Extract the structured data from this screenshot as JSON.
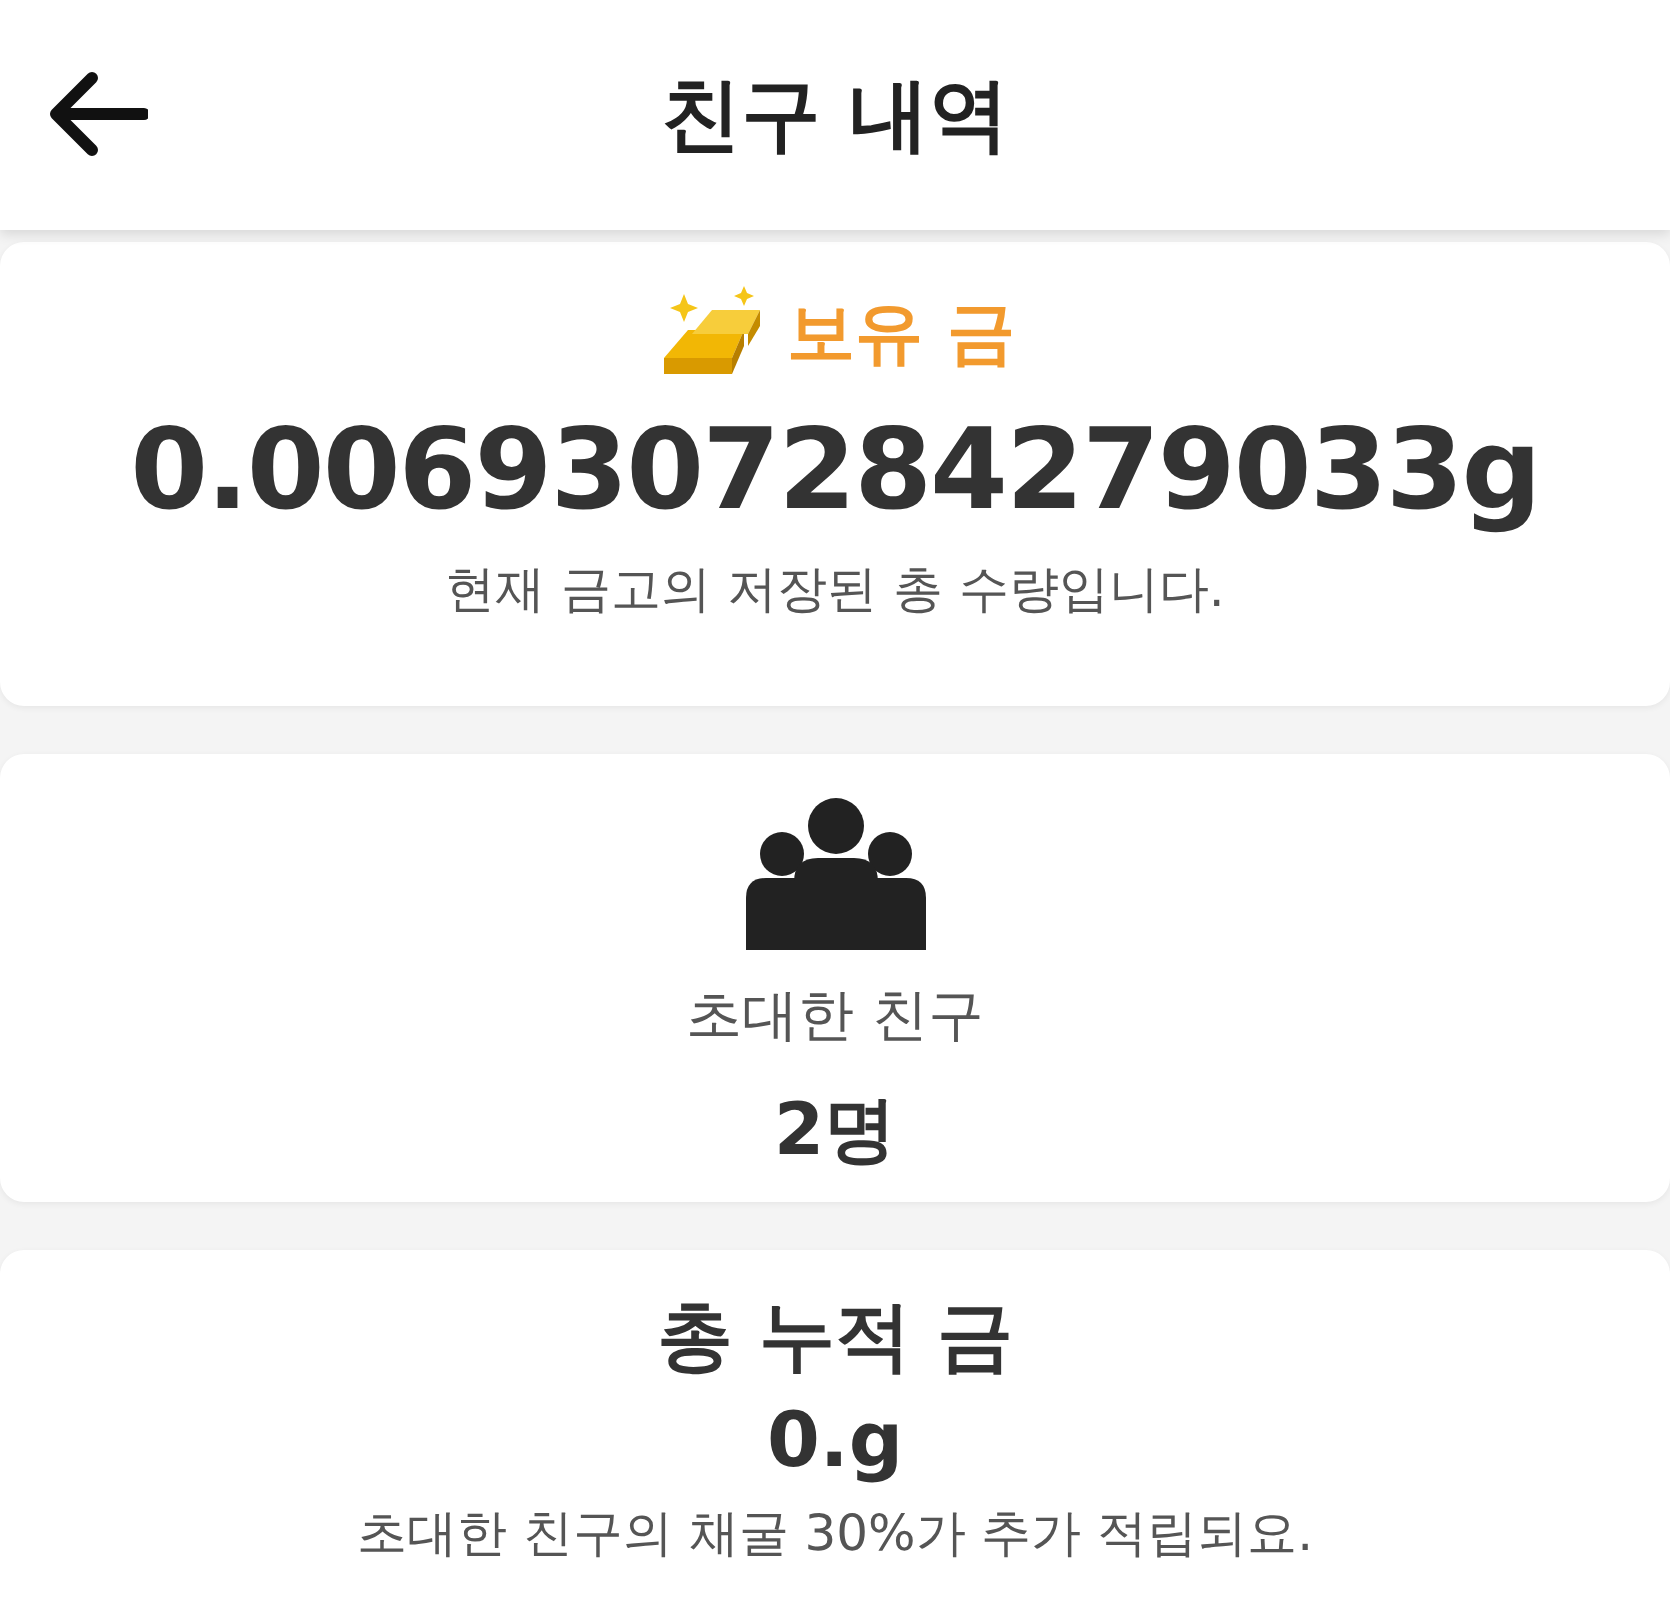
{
  "header": {
    "title": "친구 내역"
  },
  "balance": {
    "label": "보유 금",
    "amount": "0.0069307284279033g",
    "caption": "현재 금고의 저장된 총 수량입니다."
  },
  "friends": {
    "label": "초대한 친구",
    "count": "2명"
  },
  "accumulated": {
    "title": "총 누적 금",
    "amount": "0.g",
    "caption": "초대한 친구의 채굴 30%가 추가 적립되요."
  }
}
